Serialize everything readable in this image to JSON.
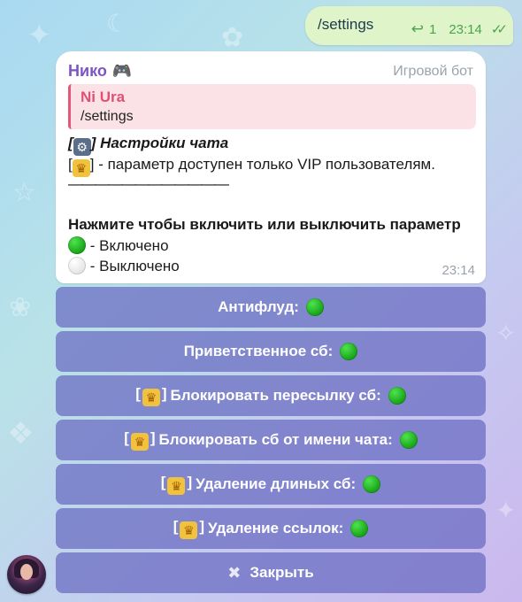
{
  "outgoing": {
    "text": "/settings",
    "reply_count": "1",
    "time": "23:14"
  },
  "incoming": {
    "sender": "Нико",
    "sender_icon": "gamepad-icon",
    "bot_label": "Игровой бот",
    "reply_author": "Ni Ura",
    "reply_text": "/settings",
    "title": "Настройки чата",
    "vip_note": " - параметр доступен только VIP пользователям.",
    "divider": "————————————",
    "instruction": "Нажмите чтобы включить или выключить параметр",
    "on_legend": " - Включено",
    "off_legend": " - Выключено",
    "time": "23:14"
  },
  "keyboard": [
    {
      "label": "Антифлуд:",
      "vip": false,
      "state": "on"
    },
    {
      "label": "Приветственное сб:",
      "vip": false,
      "state": "on"
    },
    {
      "label": "Блокировать пересылку сб:",
      "vip": true,
      "state": "on"
    },
    {
      "label": "Блокировать сб от имени чата:",
      "vip": true,
      "state": "on"
    },
    {
      "label": "Удаление длиных сб:",
      "vip": true,
      "state": "on"
    },
    {
      "label": "Удаление ссылок:",
      "vip": true,
      "state": "on"
    }
  ],
  "close_label": "Закрыть",
  "colors": {
    "accent_on": "#17a317",
    "button_bg": "#686ac0",
    "sender": "#7b55c6",
    "reply_author": "#e04f74",
    "outgoing_bubble": "#dff5c9"
  }
}
